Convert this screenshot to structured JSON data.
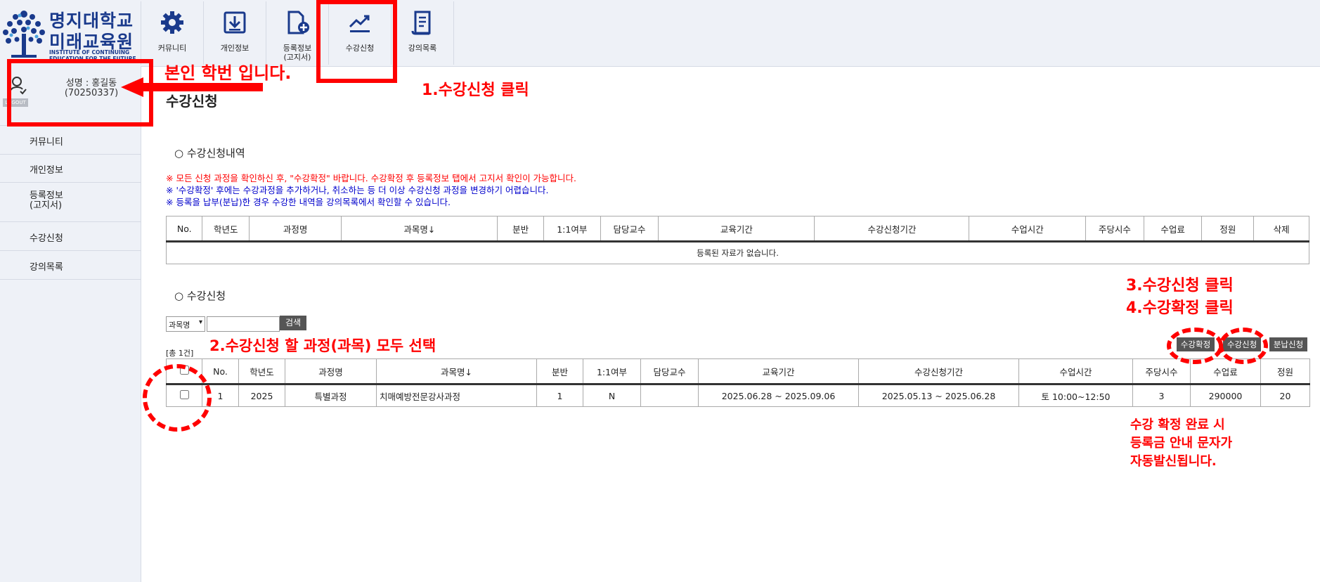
{
  "logo": {
    "kr_line1": "명지대학교",
    "kr_line2": "미래교육원",
    "en_line1": "INSTITUTE OF CONTINUING",
    "en_line2": "EDUCATION FOR THE FUTURE"
  },
  "topnav": [
    {
      "label": "커뮤니티",
      "icon": "gear-icon"
    },
    {
      "label": "개인정보",
      "icon": "download-box-icon"
    },
    {
      "label": "등록정보",
      "label2": "(고지서)",
      "icon": "document-plus-icon"
    },
    {
      "label": "수강신청",
      "icon": "chart-line-icon"
    },
    {
      "label": "강의목록",
      "icon": "list-document-icon"
    }
  ],
  "user": {
    "name_line": "성명 : 홍길동",
    "id_line": "(70250337)",
    "logout": "LOGOUT"
  },
  "sidebar": [
    {
      "label": "커뮤니티"
    },
    {
      "label": "개인정보"
    },
    {
      "label": "등록정보",
      "label2": "(고지서)"
    },
    {
      "label": "수강신청"
    },
    {
      "label": "강의목록"
    }
  ],
  "page_title": "수강신청",
  "history": {
    "title": "○ 수강신청내역",
    "notices": [
      {
        "text": "※ 모든 신청 과정을 확인하신 후, \"수강확정\" 바랍니다. 수강확정 후 등록정보 탭에서 고지서 확인이 가능합니다.",
        "color": "#ff0000"
      },
      {
        "text": "※ '수강확정' 후에는 수강과정을 추가하거나, 취소하는 등 더 이상 수강신청 과정을 변경하기 어렵습니다.",
        "color": "#0000cc"
      },
      {
        "text": "※ 등록을 납부(분납)한 경우 수강한 내역을 강의목록에서 확인할 수 있습니다.",
        "color": "#0000cc"
      }
    ],
    "columns": [
      "No.",
      "학년도",
      "과정명",
      "과목명↓",
      "분반",
      "1:1여부",
      "담당교수",
      "교육기간",
      "수강신청기간",
      "수업시간",
      "주당시수",
      "수업료",
      "정원",
      "삭제"
    ],
    "empty_message": "등록된 자료가 없습니다."
  },
  "apply": {
    "title": "○ 수강신청",
    "search_select": "과목명",
    "search_placeholder": "",
    "search_button": "검색",
    "total": "[총 1건]",
    "buttons": {
      "confirm": "수강확정",
      "apply": "수강신청",
      "installment": "분납신청"
    },
    "columns": [
      "No.",
      "학년도",
      "과정명",
      "과목명↓",
      "분반",
      "1:1여부",
      "담당교수",
      "교육기간",
      "수강신청기간",
      "수업시간",
      "주당시수",
      "수업료",
      "정원"
    ],
    "rows": [
      {
        "no": "1",
        "year": "2025",
        "course": "특별과정",
        "subject": "치매예방전문강사과정",
        "section": "1",
        "oneone": "N",
        "professor": "",
        "period": "2025.06.28 ~ 2025.09.06",
        "apply_period": "2025.05.13 ~ 2025.06.28",
        "time": "토 10:00~12:50",
        "hours": "3",
        "fee": "290000",
        "capacity": "20"
      }
    ]
  },
  "annotations": {
    "student_id_note": "본인 학번 입니다.",
    "step1": "1.수강신청 클릭",
    "step2": "2.수강신청 할 과정(과목) 모두 선택",
    "step3": "3.수강신청 클릭",
    "step4": "4.수강확정 클릭",
    "sms_line1": "수강 확정 완료 시",
    "sms_line2": "등록금 안내 문자가",
    "sms_line3": "자동발신됩니다.",
    "color": "#ff0000"
  }
}
